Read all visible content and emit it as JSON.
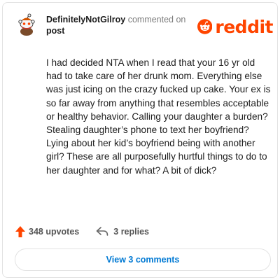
{
  "header": {
    "username": "DefinitelyNotGilroy",
    "action_text": "commented on",
    "post_link": "post"
  },
  "logo": {
    "wordmark": "reddit",
    "icon": "reddit-snoo-icon",
    "color": "#ff4500"
  },
  "avatar": {
    "icon": "snoo-avatar-icon"
  },
  "comment": {
    "text": "I had decided NTA when I read that your 16 yr old had to take care of her drunk mom. Everything else was just icing on the crazy fucked up cake. Your ex is so far away from anything that resembles acceptable or healthy behavior. Calling your daughter a burden? Stealing daughter’s phone to text her boyfriend? Lying about her kid’s boyfriend being with another girl? These are all purposefully hurtful things to do to her daughter and for what? A bit of dick?"
  },
  "actions": {
    "upvotes_label": "348 upvotes",
    "upvote_icon": "upvote-arrow-icon",
    "upvote_color": "#ff4500",
    "replies_label": "3 replies",
    "reply_icon": "reply-arrow-icon"
  },
  "footer": {
    "view_comments_label": "View 3 comments",
    "link_color": "#0079d3"
  }
}
